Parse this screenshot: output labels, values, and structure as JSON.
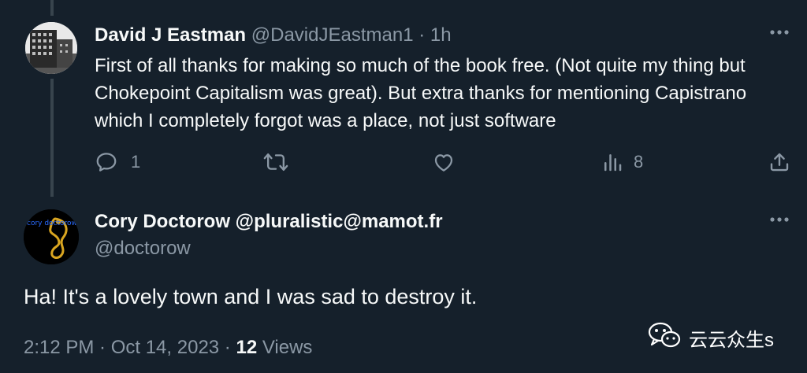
{
  "tweet": {
    "author_name": "David J Eastman",
    "author_handle": "@DavidJEastman1",
    "time": "· 1h",
    "text": "First of all thanks for making so much of the book free. (Not quite my thing but Chokepoint Capitalism was great). But extra thanks for mentioning Capistrano which I completely forgot was a place, not just software",
    "reply_count": "1",
    "views_count": "8",
    "icons": {
      "reply": "reply-icon",
      "retweet": "retweet-icon",
      "like": "like-icon",
      "views": "views-icon",
      "share": "share-icon",
      "more": "more-icon"
    }
  },
  "reply": {
    "author_name": "Cory Doctorow @pluralistic@mamot.fr",
    "author_handle": "@doctorow",
    "text": "Ha! It's a lovely town and I was sad to destroy it.",
    "meta_time": "2:12 PM · Oct 14, 2023 · ",
    "views_num": "12",
    "views_label": " Views",
    "avatar_text": "cory doctorow"
  },
  "watermark": {
    "text": "云云众生s",
    "icon": "wechat-icon"
  },
  "colors": {
    "background": "#15202b",
    "text": "#f7f9f9",
    "muted": "#8b98a5",
    "thread_line": "#38444d"
  }
}
